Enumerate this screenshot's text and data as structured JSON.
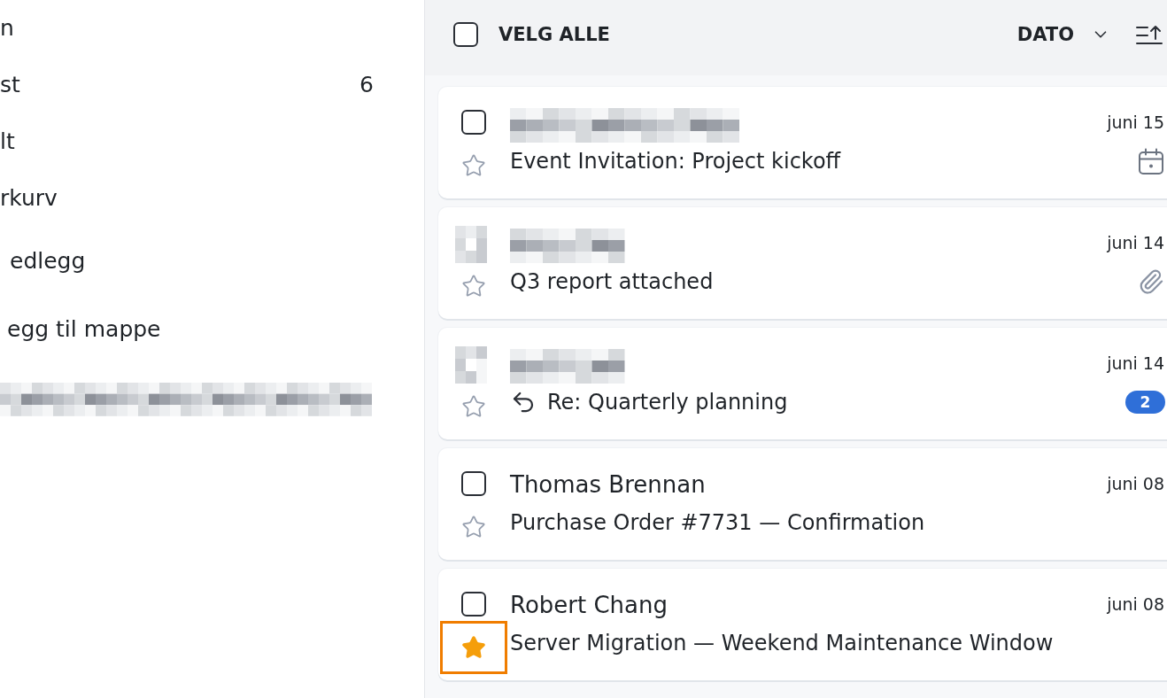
{
  "sidebar": {
    "items": [
      {
        "kind": "folder",
        "label": "n"
      },
      {
        "kind": "folder",
        "label": "st",
        "count": "6"
      },
      {
        "kind": "folder",
        "label": "lt"
      },
      {
        "kind": "folder",
        "label": "rkurv"
      },
      {
        "kind": "filter",
        "label": "edlegg"
      },
      {
        "kind": "action",
        "label": "egg til mappe"
      },
      {
        "kind": "pixelated"
      }
    ]
  },
  "list_header": {
    "select_all": {
      "label": "VELG ALLE",
      "checked": false
    },
    "sort": {
      "label": "DATO"
    }
  },
  "messages": [
    {
      "lead": {
        "kind": "checkbox",
        "checked": false
      },
      "sender": {
        "kind": "pixelated"
      },
      "date": "juni 15",
      "starred": false,
      "star_focused": false,
      "replied": false,
      "subject": "Event Invitation: Project kickoff",
      "indicator": {
        "kind": "calendar"
      }
    },
    {
      "lead": {
        "kind": "pixelated"
      },
      "sender": {
        "kind": "pixelated"
      },
      "date": "juni 14",
      "starred": false,
      "star_focused": false,
      "replied": false,
      "subject": "Q3 report attached",
      "indicator": {
        "kind": "attachment"
      }
    },
    {
      "lead": {
        "kind": "pixelated"
      },
      "sender": {
        "kind": "pixelated"
      },
      "date": "juni 14",
      "starred": false,
      "star_focused": false,
      "replied": true,
      "subject": "Re: Quarterly planning",
      "indicator": {
        "kind": "count",
        "text": "2"
      }
    },
    {
      "lead": {
        "kind": "checkbox",
        "checked": false
      },
      "sender": {
        "kind": "name",
        "text": "Thomas Brennan"
      },
      "date": "juni 08",
      "starred": false,
      "star_focused": false,
      "replied": false,
      "subject": "Purchase Order #7731 — Confirmation"
    },
    {
      "lead": {
        "kind": "checkbox",
        "checked": false
      },
      "sender": {
        "kind": "name",
        "text": "Robert Chang"
      },
      "date": "juni 08",
      "starred": true,
      "star_focused": true,
      "replied": false,
      "subject": "Server Migration — Weekend Maintenance Window"
    }
  ]
}
